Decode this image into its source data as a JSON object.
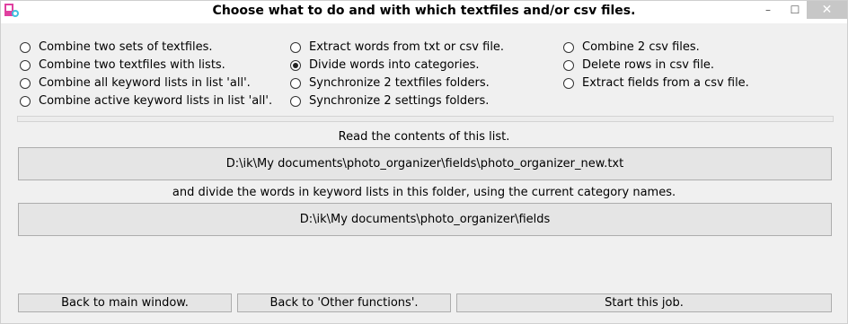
{
  "window": {
    "title": "Choose what to do and with which textfiles and/or csv files.",
    "controls": {
      "minimize": "–",
      "maximize": "☐",
      "close": "✕"
    }
  },
  "options": {
    "col1": [
      {
        "label": "Combine two sets of textfiles.",
        "checked": false
      },
      {
        "label": "Combine two textfiles with lists.",
        "checked": false
      },
      {
        "label": "Combine all keyword lists in list 'all'.",
        "checked": false
      },
      {
        "label": "Combine active keyword lists in list 'all'.",
        "checked": false
      }
    ],
    "col2": [
      {
        "label": "Extract words from txt or csv file.",
        "checked": false
      },
      {
        "label": "Divide words into categories.",
        "checked": true
      },
      {
        "label": "Synchronize 2 textfiles folders.",
        "checked": false
      },
      {
        "label": "Synchronize 2 settings folders.",
        "checked": false
      }
    ],
    "col3": [
      {
        "label": "Combine 2 csv files.",
        "checked": false
      },
      {
        "label": "Delete rows in csv file.",
        "checked": false
      },
      {
        "label": "Extract fields from a csv file.",
        "checked": false
      }
    ]
  },
  "main": {
    "caption1": "Read the contents of this list.",
    "path1": "D:\\ik\\My documents\\photo_organizer\\fields\\photo_organizer_new.txt",
    "caption2": "and divide the words in keyword lists in this folder, using the current category names.",
    "path2": "D:\\ik\\My documents\\photo_organizer\\fields"
  },
  "buttons": {
    "back_main": "Back to main window.",
    "back_other": "Back to 'Other functions'.",
    "start": "Start this job."
  }
}
